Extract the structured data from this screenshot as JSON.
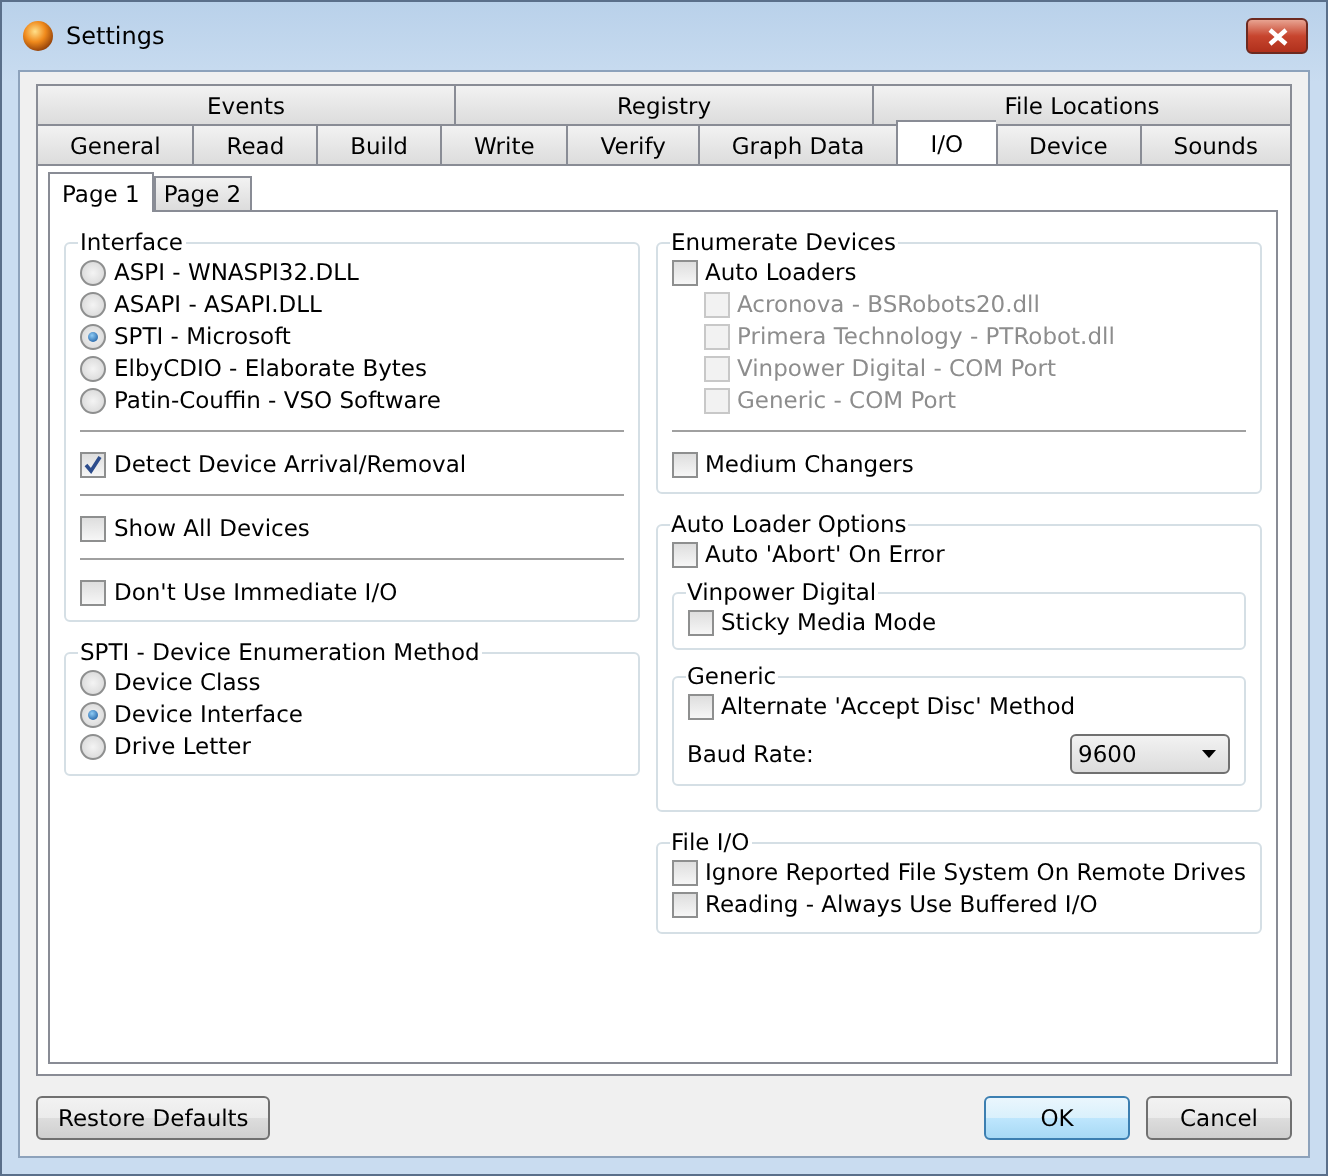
{
  "window": {
    "title": "Settings"
  },
  "tab_rows": [
    [
      {
        "label": "Events",
        "selected": false
      },
      {
        "label": "Registry",
        "selected": false
      },
      {
        "label": "File Locations",
        "selected": false
      }
    ],
    [
      {
        "label": "General",
        "selected": false
      },
      {
        "label": "Read",
        "selected": false
      },
      {
        "label": "Build",
        "selected": false
      },
      {
        "label": "Write",
        "selected": false
      },
      {
        "label": "Verify",
        "selected": false
      },
      {
        "label": "Graph Data",
        "selected": false
      },
      {
        "label": "I/O",
        "selected": true
      },
      {
        "label": "Device",
        "selected": false
      },
      {
        "label": "Sounds",
        "selected": false
      }
    ]
  ],
  "subtabs": [
    {
      "label": "Page 1",
      "selected": true
    },
    {
      "label": "Page 2",
      "selected": false
    }
  ],
  "left_column": [
    {
      "title": "Interface",
      "sections": [
        [
          {
            "kind": "radio",
            "label": "ASPI - WNASPI32.DLL",
            "selected": false
          },
          {
            "kind": "radio",
            "label": "ASAPI - ASAPI.DLL",
            "selected": false
          },
          {
            "kind": "radio",
            "label": "SPTI - Microsoft",
            "selected": true
          },
          {
            "kind": "radio",
            "label": "ElbyCDIO - Elaborate Bytes",
            "selected": false
          },
          {
            "kind": "radio",
            "label": "Patin-Couffin - VSO Software",
            "selected": false
          }
        ],
        [
          {
            "kind": "checkbox",
            "label": "Detect Device Arrival/Removal",
            "checked": true,
            "disabled": false
          }
        ],
        [
          {
            "kind": "checkbox",
            "label": "Show All Devices",
            "checked": false,
            "disabled": false
          }
        ],
        [
          {
            "kind": "checkbox",
            "label": "Don't Use Immediate I/O",
            "checked": false,
            "disabled": false
          }
        ]
      ]
    },
    {
      "title": "SPTI - Device Enumeration Method",
      "sections": [
        [
          {
            "kind": "radio",
            "label": "Device Class",
            "selected": false
          },
          {
            "kind": "radio",
            "label": "Device Interface",
            "selected": true
          },
          {
            "kind": "radio",
            "label": "Drive Letter",
            "selected": false
          }
        ]
      ]
    }
  ],
  "right_column": [
    {
      "title": "Enumerate Devices",
      "sections": [
        [
          {
            "kind": "checkbox",
            "label": "Auto Loaders",
            "checked": false,
            "disabled": false,
            "children": [
              {
                "kind": "checkbox",
                "label": "Acronova - BSRobots20.dll",
                "checked": false,
                "disabled": true
              },
              {
                "kind": "checkbox",
                "label": "Primera Technology - PTRobot.dll",
                "checked": false,
                "disabled": true
              },
              {
                "kind": "checkbox",
                "label": "Vinpower Digital - COM Port",
                "checked": false,
                "disabled": true
              },
              {
                "kind": "checkbox",
                "label": "Generic - COM Port",
                "checked": false,
                "disabled": true
              }
            ]
          }
        ],
        [
          {
            "kind": "checkbox",
            "label": "Medium Changers",
            "checked": false,
            "disabled": false
          }
        ]
      ]
    },
    {
      "title": "Auto Loader Options",
      "sections": [
        [
          {
            "kind": "checkbox",
            "label": "Auto 'Abort' On Error",
            "checked": false,
            "disabled": false
          },
          {
            "kind": "group",
            "title": "Vinpower Digital",
            "items": [
              {
                "kind": "checkbox",
                "label": "Sticky Media Mode",
                "checked": false,
                "disabled": false
              }
            ]
          },
          {
            "kind": "group",
            "title": "Generic",
            "items": [
              {
                "kind": "checkbox",
                "label": "Alternate 'Accept Disc' Method",
                "checked": false,
                "disabled": false
              },
              {
                "kind": "select",
                "label": "Baud Rate:",
                "value": "9600"
              }
            ]
          }
        ]
      ]
    },
    {
      "title": "File I/O",
      "sections": [
        [
          {
            "kind": "checkbox",
            "label": "Ignore Reported File System On Remote Drives",
            "checked": false,
            "disabled": false
          },
          {
            "kind": "checkbox",
            "label": "Reading - Always Use Buffered I/O",
            "checked": false,
            "disabled": false
          }
        ]
      ]
    }
  ],
  "buttons": {
    "left": [
      "Restore Defaults"
    ],
    "right": [
      {
        "label": "OK",
        "default": true
      },
      {
        "label": "Cancel",
        "default": false
      }
    ]
  }
}
